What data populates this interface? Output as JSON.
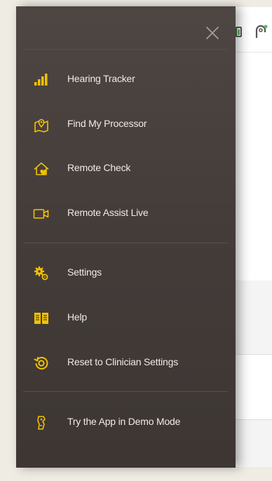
{
  "background_app": {
    "battery_icon": "battery-icon",
    "processor_icon": "processor-icon"
  },
  "drawer": {
    "close_icon": "close-icon",
    "accent_color": "#f2c200",
    "text_color": "#efebe6",
    "background_color": "#463f3c",
    "groups": [
      {
        "items": [
          {
            "label": "Hearing Tracker",
            "icon": "signal-bars-icon"
          },
          {
            "label": "Find My Processor",
            "icon": "map-pin-icon"
          },
          {
            "label": "Remote Check",
            "icon": "home-heart-icon"
          },
          {
            "label": "Remote Assist Live",
            "icon": "video-camera-icon"
          }
        ]
      },
      {
        "items": [
          {
            "label": "Settings",
            "icon": "gears-icon"
          },
          {
            "label": "Help",
            "icon": "book-icon"
          },
          {
            "label": "Reset to Clinician Settings",
            "icon": "reset-icon"
          }
        ]
      },
      {
        "items": [
          {
            "label": "Try the App in Demo Mode",
            "icon": "demo-device-icon"
          }
        ]
      }
    ]
  }
}
